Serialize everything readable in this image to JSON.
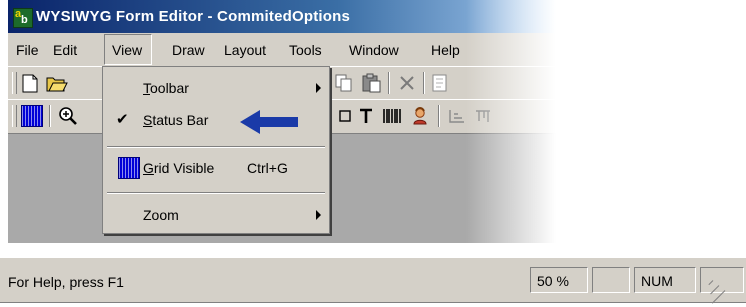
{
  "window": {
    "title": "WYSIWYG Form Editor - CommitedOptions"
  },
  "menubar": {
    "items": [
      "File",
      "Edit",
      "View",
      "Draw",
      "Layout",
      "Tools",
      "Window",
      "Help"
    ],
    "active": "View"
  },
  "view_menu": {
    "items": [
      {
        "label": "Toolbar",
        "mnemonic": "T",
        "rest": "oolbar",
        "has_submenu": true,
        "checked": false,
        "shortcut": ""
      },
      {
        "label": "Status Bar",
        "mnemonic": "S",
        "rest": "tatus Bar",
        "has_submenu": false,
        "checked": true,
        "shortcut": ""
      },
      {
        "label": "Grid Visible",
        "mnemonic": "G",
        "rest": "rid Visible",
        "has_submenu": false,
        "checked": false,
        "shortcut": "Ctrl+G"
      },
      {
        "label": "Zoom",
        "mnemonic": "",
        "rest": "Zoom",
        "has_submenu": true,
        "checked": false,
        "shortcut": ""
      }
    ]
  },
  "statusbar": {
    "help_text": "For Help, press F1",
    "zoom": "50 %",
    "num": "NUM"
  },
  "colors": {
    "titlebar_start": "#0a246a",
    "titlebar_end": "#a6caf0",
    "annotation_arrow": "#1a3aa8",
    "face": "#d4d0c8"
  },
  "icons": [
    "app-icon",
    "new-file-icon",
    "open-folder-icon",
    "help-icon",
    "cut-icon",
    "copy-icon",
    "paste-icon",
    "delete-icon",
    "grid-icon",
    "zoom-icon",
    "text-tool-icon",
    "barcode-icon",
    "image-icon",
    "align-icon",
    "check-icon",
    "submenu-arrow-icon",
    "annotation-arrow-icon"
  ]
}
